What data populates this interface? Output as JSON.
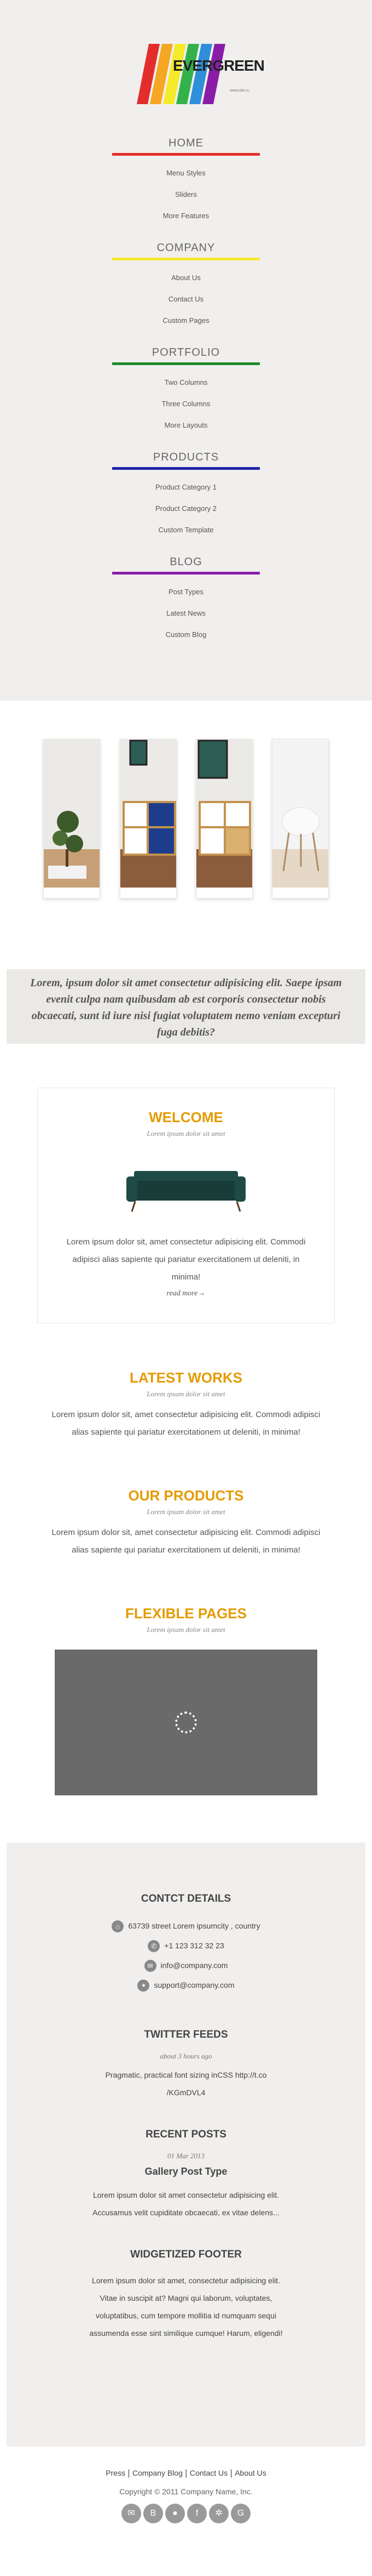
{
  "logo": {
    "text": "EVERGREEN",
    "sub": "www.site.ru"
  },
  "nav": [
    {
      "title": "HOME",
      "color": "#e32d2d",
      "items": [
        "Menu Styles",
        "Sliders",
        "More Features"
      ]
    },
    {
      "title": "COMPANY",
      "color": "#f5ea2a",
      "items": [
        "About Us",
        "Contact Us",
        "Custom Pages"
      ]
    },
    {
      "title": "PORTFOLIO",
      "color": "#1e8b2a",
      "items": [
        "Two Columns",
        "Three Columns",
        "More Layouts"
      ]
    },
    {
      "title": "PRODUCTS",
      "color": "#1f23a8",
      "items": [
        "Product Category 1",
        "Product Category 2",
        "Custom Template"
      ]
    },
    {
      "title": "BLOG",
      "color": "#8a1da8",
      "items": [
        "Post Types",
        "Latest News",
        "Custom Blog"
      ]
    }
  ],
  "quote": "Lorem, ipsum dolor sit amet consectetur adipisicing elit. Saepe ipsam evenit culpa nam quibusdam ab est corporis consectetur nobis obcaecati, sunt id iure nisi fugiat voluptatem nemo veniam excepturi fuga debitis?",
  "welcome": {
    "title": "WELCOME",
    "sub": "Lorem ipsum dolor sit amet",
    "body": "Lorem ipsum dolor sit, amet consectetur adipisicing elit. Commodi adipisci alias sapiente qui pariatur exercitationem ut deleniti, in minima!",
    "readmore": "read more→"
  },
  "latest": {
    "title": "LATEST WORKS",
    "sub": "Lorem ipsum dolor sit amet",
    "body": "Lorem ipsum dolor sit, amet consectetur adipisicing elit. Commodi adipisci alias sapiente qui pariatur exercitationem ut deleniti, in minima!"
  },
  "products": {
    "title": "OUR PRODUCTS",
    "sub": "Lorem ipsum dolor sit amet",
    "body": "Lorem ipsum dolor sit, amet consectetur adipisicing elit. Commodi adipisci alias sapiente qui pariatur exercitationem ut deleniti, in minima!"
  },
  "flexible": {
    "title": "FLEXIBLE PAGES",
    "sub": "Lorem ipsum dolor sit amet"
  },
  "footer": {
    "contact_title": "CONTCT DETAILS",
    "address": "63739 street Lorem ipsumcity , country",
    "phone": "+1 123 312 32 23",
    "email": "info@company.com",
    "support": "support@company.com",
    "twitter_title": "TWITTER FEEDS",
    "twitter_date": "about 3 hours ago",
    "twitter_text": "Pragmatic, practical font sizing inCSS http://t.co /KGmDVL4",
    "posts_title": "RECENT POSTS",
    "posts_date": "01 Mar 2013",
    "posts_head": "Gallery Post Type",
    "posts_text": "Lorem ipsum dolor sit amet consectetur adipisicing elit. Accusamus velit cupiditate obcaecati, ex vitae delens...",
    "widget_title": "WIDGETIZED FOOTER",
    "widget_text": "Lorem ipsum dolor sit amet, consectetur adipisicing elit. Vitae in suscipit at? Magni qui laborum, voluptates, voluptatibus, cum tempore mollitia id numquam sequi assumenda esse sint similique cumque! Harum, eligendi!"
  },
  "bottom": {
    "links": [
      "Press",
      "Company Blog",
      "Contact Us",
      "About Us"
    ],
    "copyright": "Copyright © 2011 Company Name, Inc."
  }
}
